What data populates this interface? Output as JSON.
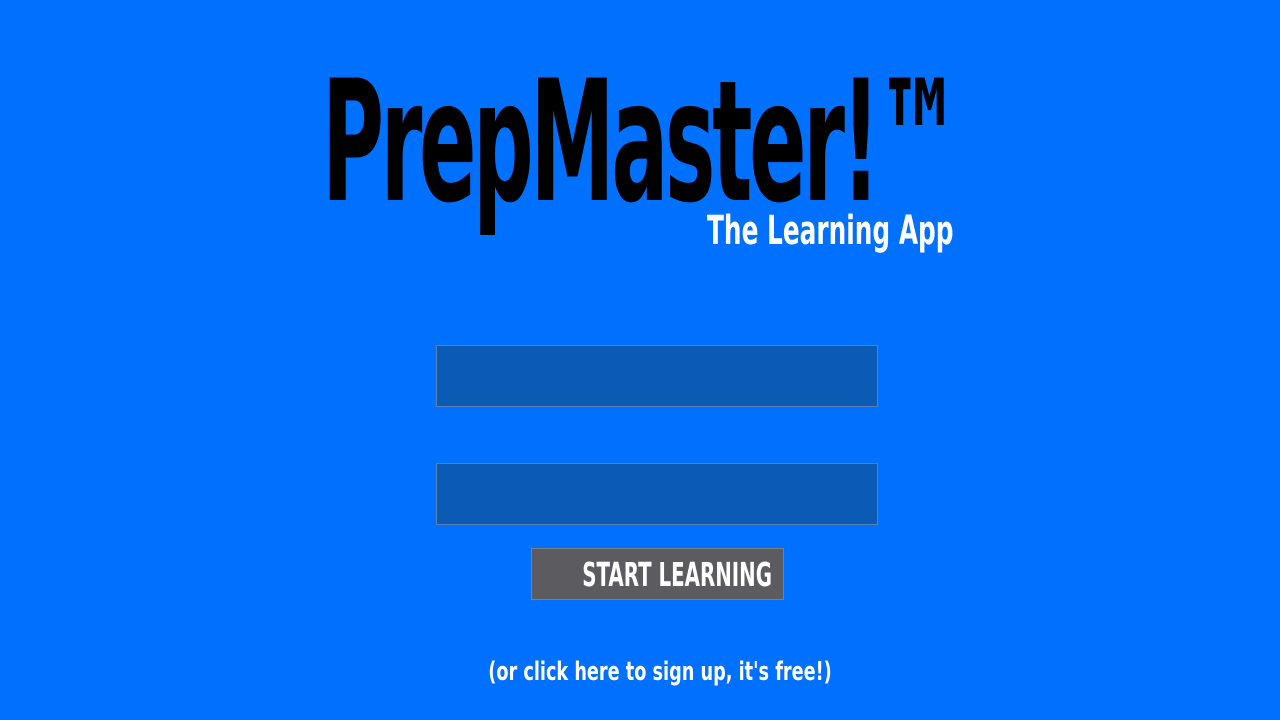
{
  "branding": {
    "app_name": "PrepMaster!™",
    "tagline": "The Learning App"
  },
  "login_form": {
    "username_field": {
      "value": "",
      "placeholder": ""
    },
    "password_field": {
      "value": "",
      "placeholder": ""
    },
    "submit_label": "START LEARNING"
  },
  "signup_link_text": "(or click here to sign up, it's free!)",
  "colors": {
    "background": "#0070ff",
    "input_fill": "#0b5ab4",
    "button_fill": "#5c5c60",
    "logo_text": "#000000",
    "light_text": "#ffffff"
  }
}
